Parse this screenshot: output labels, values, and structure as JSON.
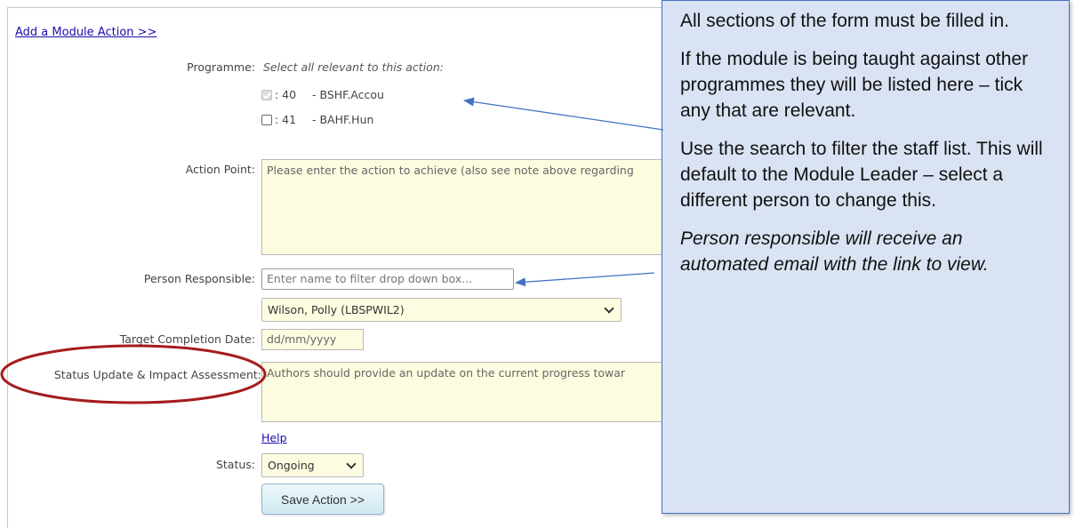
{
  "form": {
    "add_link": "Add a Module Action >>",
    "programme_label": "Programme:",
    "programme_hint": "Select all relevant to this action:",
    "programmes": [
      {
        "code": ": 40",
        "name": "- BSHF.Accou",
        "checked": true
      },
      {
        "code": ": 41",
        "name": "- BAHF.Hun",
        "checked": false
      }
    ],
    "action_point_label": "Action Point:",
    "action_point_placeholder": "Please enter the action to achieve (also see note above regarding",
    "person_label": "Person Responsible:",
    "person_filter_placeholder": "Enter name to filter drop down box...",
    "person_selected": "Wilson, Polly (LBSPWIL2)",
    "target_date_label": "Target Completion Date:",
    "target_date_placeholder": "dd/mm/yyyy",
    "status_update_label": "Status Update & Impact Assessment:",
    "status_update_placeholder": "Authors should provide an update on the current progress towar",
    "help_link": "Help",
    "status_label": "Status:",
    "status_selected": "Ongoing",
    "save_button": "Save Action >>"
  },
  "callout": {
    "p1": "All sections of the form must be filled in.",
    "p2": "If the module is being taught against other programmes they will be listed here – tick any that are relevant.",
    "p3": "Use the search to filter the staff list. This will default to the Module Leader – select a different person to change this.",
    "p4": "Person responsible will receive an automated email with the link to view."
  },
  "colors": {
    "field_background": "#fefce0",
    "callout_background": "#dae3f3",
    "callout_border": "#4472c4",
    "annotation_ellipse": "#a51c1c",
    "link": "#1a0dab"
  }
}
